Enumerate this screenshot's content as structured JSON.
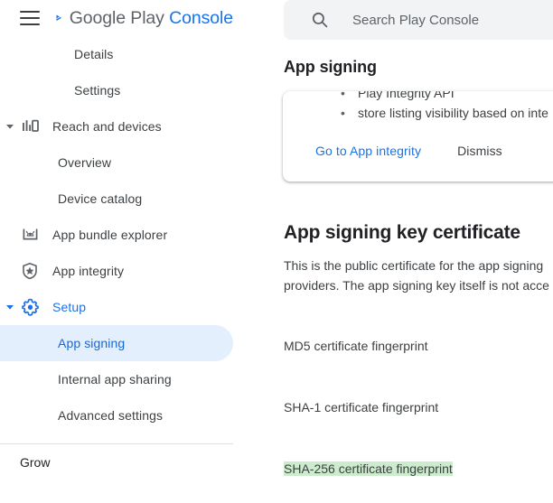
{
  "brand": {
    "menu_icon": "hamburger-menu-icon",
    "logo_icon": "google-play-console-logo",
    "name_part1": "Google Play ",
    "name_part2": "Console"
  },
  "sidebar": {
    "items": [
      {
        "label": "Details",
        "level": "subsub",
        "icon": null,
        "state": "normal",
        "caret": null
      },
      {
        "label": "Settings",
        "level": "subsub",
        "icon": null,
        "state": "normal",
        "caret": null
      },
      {
        "label": "Reach and devices",
        "level": "icon",
        "icon": "bar-chart-device-icon",
        "state": "normal",
        "caret": "down"
      },
      {
        "label": "Overview",
        "level": "sub",
        "icon": null,
        "state": "normal",
        "caret": null
      },
      {
        "label": "Device catalog",
        "level": "sub",
        "icon": null,
        "state": "normal",
        "caret": null
      },
      {
        "label": "App bundle explorer",
        "level": "icon",
        "icon": "android-bundle-icon",
        "state": "normal",
        "caret": null
      },
      {
        "label": "App integrity",
        "level": "icon",
        "icon": "shield-star-icon",
        "state": "normal",
        "caret": null
      },
      {
        "label": "Setup",
        "level": "icon",
        "icon": "gear-icon",
        "state": "expanded",
        "caret": "down-blue"
      },
      {
        "label": "App signing",
        "level": "sub",
        "icon": null,
        "state": "active",
        "caret": null
      },
      {
        "label": "Internal app sharing",
        "level": "sub",
        "icon": null,
        "state": "normal",
        "caret": null
      },
      {
        "label": "Advanced settings",
        "level": "sub",
        "icon": null,
        "state": "normal",
        "caret": null
      }
    ],
    "grow_label": "Grow"
  },
  "search": {
    "icon": "search-icon",
    "placeholder": "Search Play Console",
    "value": ""
  },
  "main": {
    "page_title": "App signing",
    "banner": {
      "bullets": [
        "Play Integrity API",
        "store listing visibility based on inte"
      ],
      "primary_action": "Go to App integrity",
      "secondary_action": "Dismiss"
    },
    "section_title": "App signing key certificate",
    "section_desc_line1": "This is the public certificate for the app signing",
    "section_desc_line2": "providers. The app signing key itself is not acce",
    "fingerprints": [
      {
        "label": "MD5 certificate fingerprint",
        "highlighted": false
      },
      {
        "label": "SHA-1 certificate fingerprint",
        "highlighted": false
      },
      {
        "label": "SHA-256 certificate fingerprint",
        "highlighted": true
      }
    ]
  },
  "colors": {
    "brand_blue": "#1a73e8",
    "active_pill_bg": "#e3effd",
    "active_text": "#1967d2",
    "search_bg": "#f1f3f4",
    "highlight_green": "#cdebcd",
    "text_primary": "#202124",
    "text_secondary": "#3c4043"
  }
}
